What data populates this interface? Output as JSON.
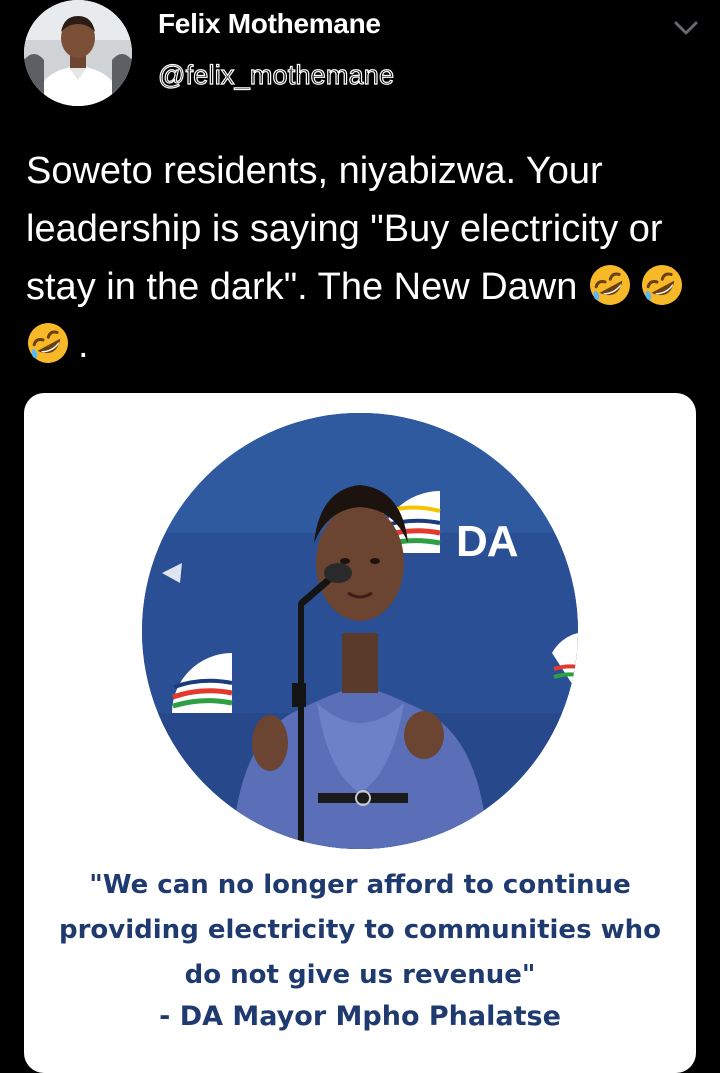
{
  "tweet": {
    "author_name": "Felix Mothemane",
    "author_handle": "@felix_mothemane",
    "text_main": "Soweto residents, niyabizwa. Your leadership is saying \"Buy electricity or stay in the dark\". The New Dawn",
    "text_end": ".",
    "emoji": [
      "rolling-on-floor-laughing-emoji",
      "rolling-on-floor-laughing-emoji",
      "rolling-on-floor-laughing-emoji"
    ],
    "menu_icon": "chevron-down-icon"
  },
  "card": {
    "logo_text": "DA",
    "quote_line1": "\"We can no longer afford to continue",
    "quote_line2": "providing electricity to communities who",
    "quote_line3": "do not give us revenue\"",
    "attribution": "- DA Mayor Mpho Phalatse"
  },
  "colors": {
    "background": "#000000",
    "text": "#ffffff",
    "quote_text": "#1f3a6e",
    "photo_bg": "#2a4f94",
    "emoji_yellow": "#f7b928"
  }
}
